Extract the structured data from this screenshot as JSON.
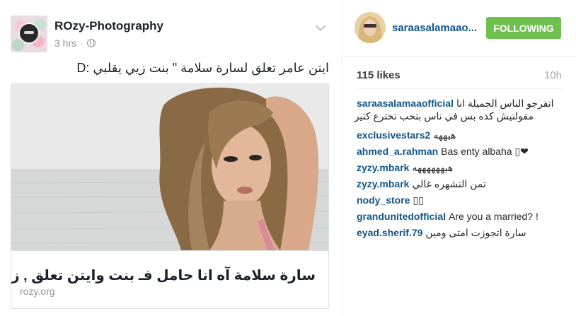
{
  "facebook_post": {
    "page_name": "ROzy-Photography",
    "time": "3 hrs",
    "separator": "·",
    "text": "ايتن عامر تعلق لسارة سلامة \" بنت زيي يقلبي :D",
    "link": {
      "title": "سارة سلامة آه انا حامل فـ بنت وايتن تعلق , زيي يقلبي",
      "domain": "rozy.org"
    }
  },
  "instagram": {
    "username": "saraasalamaao...",
    "follow_button_label": "FOLLOWING",
    "follow_button_color": "#70c050",
    "likes": "115 likes",
    "time": "10h",
    "comments": [
      {
        "user": "saraasalamaaofficial",
        "text": "اتفرجو الناس الجميلة انا",
        "text_line2": "مقولتيش كده بس في ناس بتحب تخترع كتير"
      },
      {
        "user": "exclusivestars2",
        "text": "هيههه"
      },
      {
        "user": "ahmed_a.rahman",
        "text": "Bas enty albaha ▯❤"
      },
      {
        "user": "zyzy.mbark",
        "text": "هيههههههه"
      },
      {
        "user": "zyzy.mbark",
        "text": "تمن التشهره غالي"
      },
      {
        "user": "nody_store",
        "text": "▯▯"
      },
      {
        "user": "grandunitedofficial",
        "text": "Are you a married? !"
      },
      {
        "user": "eyad.sherif.79",
        "text": "سارة اتجوزت امتى ومين"
      }
    ],
    "link_color": "#125688"
  }
}
